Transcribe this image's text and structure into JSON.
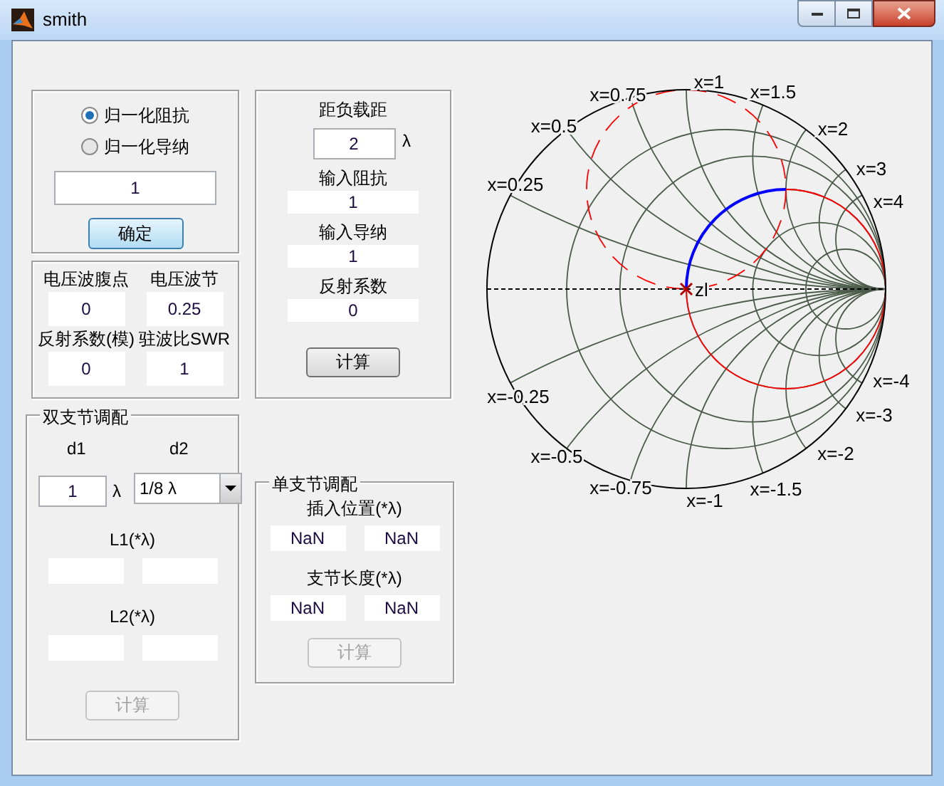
{
  "window": {
    "title": "smith"
  },
  "load_input": {
    "options": [
      {
        "label": "归一化阻抗",
        "selected": true
      },
      {
        "label": "归一化导纳",
        "selected": false
      }
    ],
    "value": "1",
    "button": "确定"
  },
  "standing_wave": {
    "fields": [
      {
        "label": "电压波腹点",
        "value": "0"
      },
      {
        "label": "电压波节",
        "value": "0.25"
      },
      {
        "label": "反射系数(模)",
        "value": "0"
      },
      {
        "label": "驻波比SWR",
        "value": "1"
      }
    ]
  },
  "distance": {
    "label": "距负载距",
    "value": "2",
    "unit": "λ",
    "outputs": [
      {
        "label": "输入阻抗",
        "value": "1"
      },
      {
        "label": "输入导纳",
        "value": "1"
      },
      {
        "label": "反射系数",
        "value": "0"
      }
    ],
    "button": {
      "label": "计算",
      "disabled": false
    }
  },
  "double_stub": {
    "title": "双支节调配",
    "d1_label": "d1",
    "d1_value": "1",
    "d1_unit": "λ",
    "d2_label": "d2",
    "d2_value": "1/8 λ",
    "l1_label": "L1(*λ)",
    "l2_label": "L2(*λ)",
    "button": {
      "label": "计算",
      "disabled": true
    }
  },
  "single_stub": {
    "title": "单支节调配",
    "position_label": "插入位置(*λ)",
    "position_values": [
      "NaN",
      "NaN"
    ],
    "length_label": "支节长度(*λ)",
    "length_values": [
      "NaN",
      "NaN"
    ],
    "button": {
      "label": "计算",
      "disabled": true
    }
  },
  "smith_chart": {
    "reactance_labels": [
      "x=1",
      "x=0.75",
      "x=1.5",
      "x=0.5",
      "x=2",
      "x=3",
      "x=0.25",
      "x=4",
      "x=-4",
      "x=-0.25",
      "x=-3",
      "x=-2",
      "x=-0.5",
      "x=-1.5",
      "x=-0.75",
      "x=-1"
    ],
    "point_label": "zl"
  }
}
